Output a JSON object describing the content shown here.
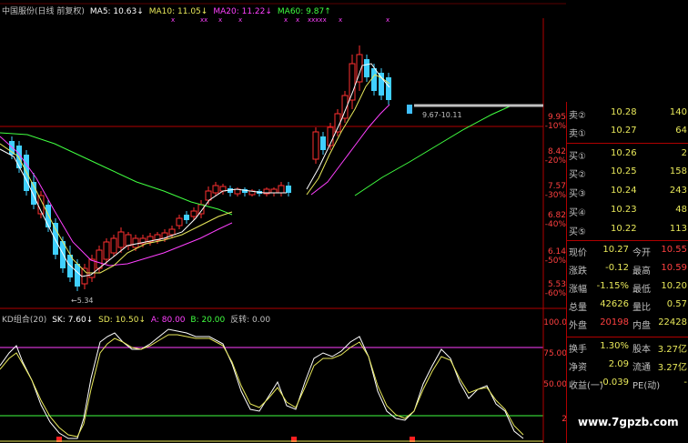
{
  "main_header": {
    "title": "中国服份(日线 前复权)",
    "ma5": "MA5: 10.63↓",
    "ma10": "MA10: 11.05↓",
    "ma20": "MA20: 11.22↓",
    "ma60": "MA60: 9.87↑",
    "colors": {
      "title": "#c0c0c0",
      "ma5": "#ffffff",
      "ma10": "#e8e85a",
      "ma20": "#ff40ff",
      "ma60": "#40ff40"
    }
  },
  "price_axis": {
    "labels": [
      {
        "price": "9.95",
        "pct": "-10%"
      },
      {
        "price": "8.42",
        "pct": "-20%"
      },
      {
        "price": "7.57",
        "pct": "-30%"
      },
      {
        "price": "6.82",
        "pct": "-40%"
      },
      {
        "price": "6.14",
        "pct": "-50%"
      },
      {
        "price": "5.53",
        "pct": "-60%"
      }
    ]
  },
  "annotations": {
    "low": "←5.34",
    "range": "9.67-10.11"
  },
  "kd_header": {
    "title": "KD组合(20)",
    "sk": "SK: 7.60↓",
    "sd": "SD: 10.50↓",
    "a": "A: 80.00",
    "b": "B: 20.00",
    "fz": "反转: 0.00"
  },
  "kd_axis": [
    "100.0",
    "75.00",
    "50.00",
    "2"
  ],
  "order_book": {
    "sell": [
      {
        "label": "卖②",
        "price": "10.28",
        "vol": "140"
      },
      {
        "label": "卖①",
        "price": "10.27",
        "vol": "64"
      }
    ],
    "buy": [
      {
        "label": "买①",
        "price": "10.26",
        "vol": "2"
      },
      {
        "label": "买②",
        "price": "10.25",
        "vol": "158"
      },
      {
        "label": "买③",
        "price": "10.24",
        "vol": "243"
      },
      {
        "label": "买④",
        "price": "10.23",
        "vol": "48"
      },
      {
        "label": "买⑤",
        "price": "10.22",
        "vol": "113"
      }
    ]
  },
  "quote": [
    {
      "l1": "现价",
      "v1": "10.27",
      "l2": "今开",
      "v2": "10.55"
    },
    {
      "l1": "涨跌",
      "v1": "-0.12",
      "l2": "最高",
      "v2": "10.59"
    },
    {
      "l1": "涨幅",
      "v1": "-1.15%",
      "l2": "最低",
      "v2": "10.20"
    },
    {
      "l1": "总量",
      "v1": "42626",
      "l2": "量比",
      "v2": "0.57"
    },
    {
      "l1": "外盘",
      "v1": "20198",
      "l2": "内盘",
      "v2": "22428"
    }
  ],
  "fundamentals": [
    {
      "l1": "换手",
      "v1": "1.30%",
      "l2": "股本",
      "v2": "3.27亿"
    },
    {
      "l1": "净资",
      "v1": "2.09",
      "l2": "流通",
      "v2": "3.27亿"
    },
    {
      "l1": "收益(一)",
      "v1": "-0.039",
      "l2": "PE(动)",
      "v2": "-"
    }
  ],
  "watermark": "www.7gpzb.com"
}
